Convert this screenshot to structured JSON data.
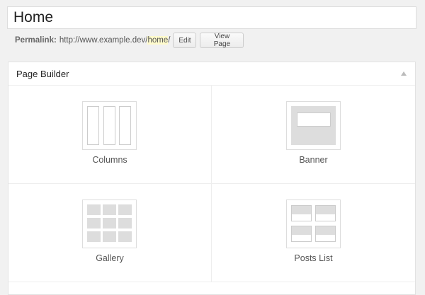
{
  "page": {
    "title_value": "Home"
  },
  "permalink": {
    "label": "Permalink:",
    "url_prefix": "http://www.example.dev/",
    "slug": "home",
    "trailing": "/",
    "edit_label": "Edit",
    "view_label": "View Page"
  },
  "panel": {
    "title": "Page Builder",
    "collapse_icon": "triangle-up-icon"
  },
  "modules": [
    {
      "label": "Columns",
      "icon": "columns-layout-icon"
    },
    {
      "label": "Banner",
      "icon": "banner-layout-icon"
    },
    {
      "label": "Gallery",
      "icon": "gallery-grid-icon"
    },
    {
      "label": "Posts List",
      "icon": "posts-list-icon"
    }
  ],
  "colors": {
    "background": "#f1f1f1",
    "panel": "#ffffff",
    "slug_highlight": "#fffbcc",
    "placeholder_gray": "#dddddd"
  }
}
